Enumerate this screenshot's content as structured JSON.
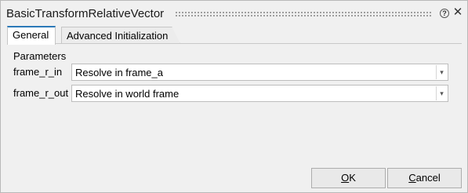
{
  "window": {
    "title": "BasicTransformRelativeVector",
    "help_glyph": "?",
    "close_glyph": "✕"
  },
  "tabs": [
    {
      "label": "General",
      "active": true
    },
    {
      "label": "Advanced Initialization",
      "active": false
    }
  ],
  "parameters": {
    "group_label": "Parameters",
    "rows": [
      {
        "label": "frame_r_in",
        "value": "Resolve in frame_a"
      },
      {
        "label": "frame_r_out",
        "value": "Resolve in world frame"
      }
    ],
    "dropdown_glyph": "▾"
  },
  "buttons": {
    "ok_mnemonic": "O",
    "ok_rest": "K",
    "cancel_mnemonic": "C",
    "cancel_rest": "ancel"
  },
  "icons": {
    "help": "help-circle-icon",
    "close": "close-icon",
    "dropdown": "chevron-down-icon"
  },
  "colors": {
    "active_tab_accent": "#2b79b8",
    "window_bg": "#f0f0f0"
  }
}
